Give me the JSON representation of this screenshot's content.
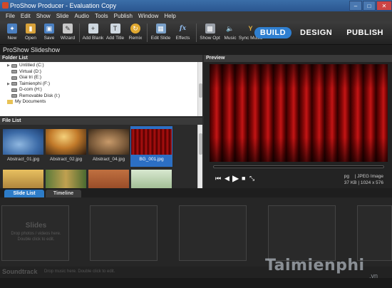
{
  "window": {
    "title": "ProShow Producer - Evaluation Copy"
  },
  "menu": [
    "File",
    "Edit",
    "Show",
    "Slide",
    "Audio",
    "Tools",
    "Publish",
    "Window",
    "Help"
  ],
  "toolbar": {
    "tools": [
      {
        "label": "New",
        "icon": "new-show-icon",
        "color": "#4a7fc0"
      },
      {
        "label": "Open",
        "icon": "open-folder-icon",
        "color": "#d8a23a"
      },
      {
        "label": "Save",
        "icon": "save-disk-icon",
        "color": "#4a7fc0"
      },
      {
        "label": "Wizard",
        "icon": "wizard-icon",
        "color": "#c8c8c8"
      },
      {
        "label": "Add Blank",
        "icon": "add-blank-icon",
        "color": "#cfd8e0"
      },
      {
        "label": "Add Title",
        "icon": "add-title-icon",
        "color": "#cfd8e0"
      },
      {
        "label": "Remix",
        "icon": "remix-icon",
        "color": "#e0a830"
      },
      {
        "label": "Edit Slide",
        "icon": "edit-slide-icon",
        "color": "#7aa0c8"
      },
      {
        "label": "Effects",
        "icon": "effects-fx-icon",
        "color": "#3a5f90"
      },
      {
        "label": "Show Opt",
        "icon": "show-options-icon",
        "color": "#9aa0a8"
      },
      {
        "label": "Music",
        "icon": "music-speaker-icon",
        "color": "#aab0b8"
      },
      {
        "label": "Sync Music",
        "icon": "sync-music-icon",
        "color": "#e0b040"
      }
    ],
    "modes": [
      {
        "label": "BUILD",
        "active": true
      },
      {
        "label": "DESIGN",
        "active": false
      },
      {
        "label": "PUBLISH",
        "active": false
      }
    ]
  },
  "show": {
    "name": "ProShow Slideshow"
  },
  "folder_list": {
    "header": "Folder List",
    "items": [
      {
        "label": "Untitled (C:)",
        "type": "drive"
      },
      {
        "label": "Virtual (D:)",
        "type": "drive"
      },
      {
        "label": "Giai tri (E:)",
        "type": "drive"
      },
      {
        "label": "Taimienphi (F:)",
        "type": "drive"
      },
      {
        "label": "D-com (H:)",
        "type": "drive"
      },
      {
        "label": "Removable Disk (I:)",
        "type": "drive"
      },
      {
        "label": "My Documents",
        "type": "folder"
      }
    ]
  },
  "file_list": {
    "header": "File List",
    "files": [
      {
        "name": "Abstract_01.jpg",
        "selected": false
      },
      {
        "name": "Abstract_02.jpg",
        "selected": false
      },
      {
        "name": "Abstract_04.jpg",
        "selected": false
      },
      {
        "name": "BG_001.jpg",
        "selected": true
      }
    ]
  },
  "preview": {
    "header": "Preview",
    "file_name_partial": "pg",
    "file_type": "JPEG Image",
    "file_size": "37 KB",
    "dimensions": "1024 x 576"
  },
  "slide_list": {
    "tabs": [
      {
        "label": "Slide List",
        "active": true
      },
      {
        "label": "Timeline",
        "active": false
      }
    ],
    "slides_title": "Slides",
    "slides_hint_line1": "Drop photos / videos here.",
    "slides_hint_line2": "Double click to edit.",
    "soundtrack_title": "Soundtrack",
    "soundtrack_hint": "Drop music here.  Double click to edit."
  },
  "watermark": {
    "text": "Taimienphi",
    "suffix": ".vn"
  },
  "colors": {
    "accent": "#2f7fd0",
    "selection": "#2c6fc4",
    "curtain": "#9a0a0a"
  }
}
